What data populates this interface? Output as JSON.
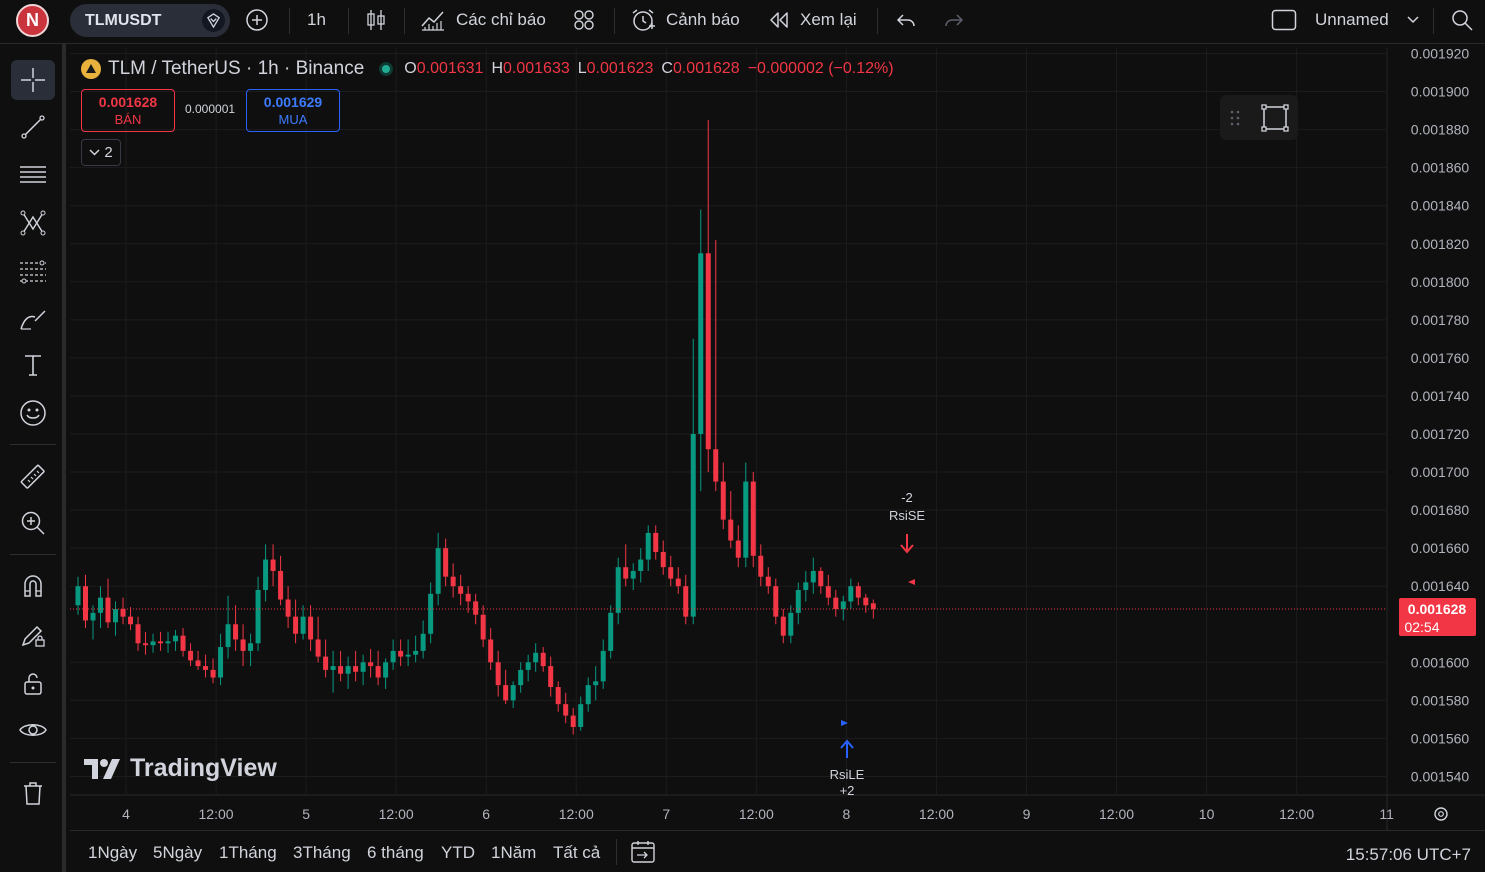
{
  "topbar": {
    "avatar_letter": "N",
    "symbol": "TLMUSDT",
    "interval": "1h",
    "indicators_label": "Các chỉ báo",
    "alert_label": "Cảnh báo",
    "replay_label": "Xem lại",
    "layout_name": "Unnamed"
  },
  "legend": {
    "title": "TLM / TetherUS · 1h · Binance",
    "o_key": "O",
    "o_val": "0.001631",
    "h_key": "H",
    "h_val": "0.001633",
    "l_key": "L",
    "l_val": "0.001623",
    "c_key": "C",
    "c_val": "0.001628",
    "change": "−0.000002 (−0.12%)"
  },
  "trade": {
    "sell_price": "0.001628",
    "sell_label": "BÁN",
    "spread": "0.000001",
    "buy_price": "0.001629",
    "buy_label": "MUA",
    "collapse_count": "2"
  },
  "logo_text": "TradingView",
  "price_axis": {
    "labels": [
      "0.001920",
      "0.001900",
      "0.001880",
      "0.001860",
      "0.001840",
      "0.001820",
      "0.001800",
      "0.001780",
      "0.001760",
      "0.001740",
      "0.001720",
      "0.001700",
      "0.001680",
      "0.001660",
      "0.001640",
      "0.001600",
      "0.001580",
      "0.001560",
      "0.001540"
    ],
    "current_price": "0.001628",
    "countdown": "02:54"
  },
  "time_axis": {
    "labels": [
      "4",
      "12:00",
      "5",
      "12:00",
      "6",
      "12:00",
      "7",
      "12:00",
      "8",
      "12:00",
      "9",
      "12:00",
      "10",
      "12:00",
      "11"
    ]
  },
  "signals": {
    "short_qty": "-2",
    "short_name": "RsiSE",
    "long_name": "RsiLE",
    "long_qty": "+2"
  },
  "colors": {
    "up": "#089981",
    "down": "#f23645",
    "price_line": "#f23645",
    "buy_blue": "#2962ff"
  },
  "bottombar": {
    "ranges": [
      "1Ngày",
      "5Ngày",
      "1Tháng",
      "3Tháng",
      "6 tháng",
      "YTD",
      "1Năm",
      "Tất cả"
    ],
    "clock": "15:57:06 UTC+7"
  },
  "chart_data": {
    "type": "candlestick",
    "title": "TLM / TetherUS · 1h · Binance",
    "ylim": [
      0.00153,
      0.00192
    ],
    "x_ticks": [
      "4",
      "12:00",
      "5",
      "12:00",
      "6",
      "12:00",
      "7",
      "12:00",
      "8",
      "12:00",
      "9",
      "12:00",
      "10",
      "12:00",
      "11"
    ],
    "candles": [
      [
        0.00163,
        0.001645,
        0.001625,
        0.00164
      ],
      [
        0.00164,
        0.001646,
        0.001618,
        0.001622
      ],
      [
        0.001622,
        0.00163,
        0.001612,
        0.001626
      ],
      [
        0.001626,
        0.00164,
        0.001618,
        0.001634
      ],
      [
        0.001634,
        0.001644,
        0.001618,
        0.001621
      ],
      [
        0.001621,
        0.001632,
        0.001614,
        0.001628
      ],
      [
        0.001628,
        0.001634,
        0.00162,
        0.001624
      ],
      [
        0.001624,
        0.001629,
        0.001617,
        0.00162
      ],
      [
        0.00162,
        0.001624,
        0.001606,
        0.00161
      ],
      [
        0.00161,
        0.001616,
        0.001604,
        0.001609
      ],
      [
        0.001609,
        0.001615,
        0.001605,
        0.001611
      ],
      [
        0.001611,
        0.001616,
        0.001606,
        0.00161
      ],
      [
        0.00161,
        0.001616,
        0.001605,
        0.001611
      ],
      [
        0.001611,
        0.001617,
        0.001606,
        0.001614
      ],
      [
        0.001614,
        0.001618,
        0.001603,
        0.001606
      ],
      [
        0.001606,
        0.00161,
        0.001598,
        0.001601
      ],
      [
        0.001601,
        0.001606,
        0.001596,
        0.001598
      ],
      [
        0.001598,
        0.001604,
        0.001592,
        0.001596
      ],
      [
        0.001596,
        0.001602,
        0.001589,
        0.001592
      ],
      [
        0.001592,
        0.001615,
        0.001588,
        0.001608
      ],
      [
        0.001608,
        0.001635,
        0.001602,
        0.00162
      ],
      [
        0.00162,
        0.00163,
        0.001606,
        0.001612
      ],
      [
        0.001612,
        0.00162,
        0.001598,
        0.001606
      ],
      [
        0.001606,
        0.001615,
        0.001598,
        0.00161
      ],
      [
        0.00161,
        0.001645,
        0.001606,
        0.001638
      ],
      [
        0.001638,
        0.001662,
        0.001632,
        0.001654
      ],
      [
        0.001654,
        0.001662,
        0.00164,
        0.001648
      ],
      [
        0.001648,
        0.001656,
        0.00163,
        0.001633
      ],
      [
        0.001633,
        0.00164,
        0.001618,
        0.001624
      ],
      [
        0.001624,
        0.001633,
        0.00161,
        0.001615
      ],
      [
        0.001615,
        0.00163,
        0.001612,
        0.001624
      ],
      [
        0.001624,
        0.00163,
        0.001606,
        0.001612
      ],
      [
        0.001612,
        0.001624,
        0.0016,
        0.001603
      ],
      [
        0.001603,
        0.001612,
        0.001592,
        0.001596
      ],
      [
        0.001596,
        0.001606,
        0.001584,
        0.001598
      ],
      [
        0.001598,
        0.001606,
        0.00159,
        0.001594
      ],
      [
        0.001594,
        0.001603,
        0.001586,
        0.001598
      ],
      [
        0.001598,
        0.001606,
        0.00159,
        0.001595
      ],
      [
        0.001595,
        0.001604,
        0.001588,
        0.0016
      ],
      [
        0.0016,
        0.001607,
        0.001592,
        0.001598
      ],
      [
        0.001598,
        0.001606,
        0.001588,
        0.001592
      ],
      [
        0.001592,
        0.001602,
        0.001586,
        0.0016
      ],
      [
        0.0016,
        0.001612,
        0.001596,
        0.001606
      ],
      [
        0.001606,
        0.001612,
        0.001598,
        0.001603
      ],
      [
        0.001603,
        0.001612,
        0.001598,
        0.001604
      ],
      [
        0.001604,
        0.001614,
        0.0016,
        0.001606
      ],
      [
        0.001606,
        0.001622,
        0.001602,
        0.001615
      ],
      [
        0.001615,
        0.001642,
        0.00161,
        0.001636
      ],
      [
        0.001636,
        0.001668,
        0.00163,
        0.00166
      ],
      [
        0.00166,
        0.001665,
        0.00164,
        0.001645
      ],
      [
        0.001645,
        0.001652,
        0.001634,
        0.00164
      ],
      [
        0.00164,
        0.001646,
        0.00163,
        0.001636
      ],
      [
        0.001636,
        0.00164,
        0.001626,
        0.001632
      ],
      [
        0.001632,
        0.001636,
        0.00162,
        0.001625
      ],
      [
        0.001625,
        0.00163,
        0.001608,
        0.001612
      ],
      [
        0.001612,
        0.001618,
        0.001596,
        0.0016
      ],
      [
        0.0016,
        0.001606,
        0.001582,
        0.001588
      ],
      [
        0.001588,
        0.001596,
        0.001578,
        0.00158
      ],
      [
        0.00158,
        0.00159,
        0.001576,
        0.001588
      ],
      [
        0.001588,
        0.0016,
        0.001584,
        0.001596
      ],
      [
        0.001596,
        0.001604,
        0.00159,
        0.0016
      ],
      [
        0.0016,
        0.00161,
        0.001595,
        0.001605
      ],
      [
        0.001605,
        0.001608,
        0.001595,
        0.001598
      ],
      [
        0.001598,
        0.001603,
        0.001582,
        0.001587
      ],
      [
        0.001587,
        0.00159,
        0.001574,
        0.001578
      ],
      [
        0.001578,
        0.001584,
        0.001568,
        0.001572
      ],
      [
        0.001572,
        0.001576,
        0.001562,
        0.001566
      ],
      [
        0.001566,
        0.001582,
        0.001564,
        0.001578
      ],
      [
        0.001578,
        0.001592,
        0.001574,
        0.001588
      ],
      [
        0.001588,
        0.001598,
        0.00158,
        0.00159
      ],
      [
        0.00159,
        0.001612,
        0.001586,
        0.001606
      ],
      [
        0.001606,
        0.00163,
        0.001602,
        0.001626
      ],
      [
        0.001626,
        0.001655,
        0.00162,
        0.00165
      ],
      [
        0.00165,
        0.001662,
        0.00164,
        0.001644
      ],
      [
        0.001644,
        0.001652,
        0.001638,
        0.001648
      ],
      [
        0.001648,
        0.00166,
        0.001642,
        0.001654
      ],
      [
        0.001654,
        0.001672,
        0.001648,
        0.001668
      ],
      [
        0.001668,
        0.001672,
        0.001654,
        0.001658
      ],
      [
        0.001658,
        0.001664,
        0.001646,
        0.00165
      ],
      [
        0.00165,
        0.001656,
        0.00164,
        0.001644
      ],
      [
        0.001644,
        0.00165,
        0.001636,
        0.00164
      ],
      [
        0.00164,
        0.001646,
        0.00162,
        0.001624
      ],
      [
        0.001624,
        0.00177,
        0.00162,
        0.00172
      ],
      [
        0.00172,
        0.001838,
        0.00169,
        0.001815
      ],
      [
        0.001815,
        0.001885,
        0.0017,
        0.001712
      ],
      [
        0.001712,
        0.001822,
        0.00169,
        0.001695
      ],
      [
        0.001695,
        0.001705,
        0.00167,
        0.001675
      ],
      [
        0.001675,
        0.00169,
        0.00166,
        0.001664
      ],
      [
        0.001664,
        0.001672,
        0.00165,
        0.001655
      ],
      [
        0.001655,
        0.001705,
        0.00165,
        0.001695
      ],
      [
        0.001695,
        0.0017,
        0.00165,
        0.001656
      ],
      [
        0.001656,
        0.001662,
        0.00164,
        0.001645
      ],
      [
        0.001645,
        0.00165,
        0.001636,
        0.00164
      ],
      [
        0.00164,
        0.001644,
        0.00162,
        0.001624
      ],
      [
        0.001624,
        0.001628,
        0.00161,
        0.001614
      ],
      [
        0.001614,
        0.00163,
        0.00161,
        0.001626
      ],
      [
        0.001626,
        0.001642,
        0.00162,
        0.001638
      ],
      [
        0.001638,
        0.001648,
        0.001632,
        0.001642
      ],
      [
        0.001642,
        0.001655,
        0.001636,
        0.001648
      ],
      [
        0.001648,
        0.00165,
        0.001636,
        0.00164
      ],
      [
        0.00164,
        0.001646,
        0.00163,
        0.001634
      ],
      [
        0.001634,
        0.001638,
        0.001624,
        0.001628
      ],
      [
        0.001628,
        0.001635,
        0.001622,
        0.001632
      ],
      [
        0.001632,
        0.001644,
        0.001628,
        0.00164
      ],
      [
        0.00164,
        0.001642,
        0.00163,
        0.001634
      ],
      [
        0.001634,
        0.001636,
        0.001626,
        0.00163
      ],
      [
        0.001631,
        0.001633,
        0.001623,
        0.001628
      ]
    ],
    "current_price": 0.001628,
    "signals": [
      {
        "label": "RsiSE",
        "qty": "-2",
        "type": "short"
      },
      {
        "label": "RsiLE",
        "qty": "+2",
        "type": "long"
      }
    ]
  }
}
